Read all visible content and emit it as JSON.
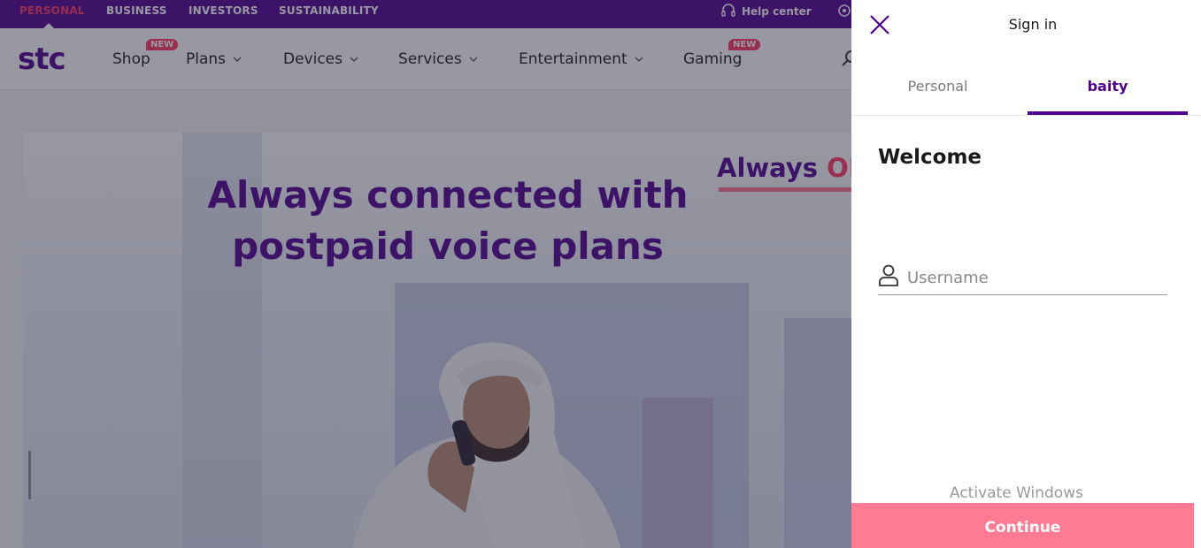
{
  "topbar": {
    "links": [
      {
        "label": "PERSONAL",
        "active": true
      },
      {
        "label": "BUSINESS",
        "active": false
      },
      {
        "label": "INVESTORS",
        "active": false
      },
      {
        "label": "SUSTAINABILITY",
        "active": false
      }
    ],
    "help_label": "Help center"
  },
  "nav": {
    "logo": "stc",
    "items": [
      {
        "label": "Shop",
        "badge": "NEW",
        "dropdown": false
      },
      {
        "label": "Plans",
        "dropdown": true
      },
      {
        "label": "Devices",
        "dropdown": true
      },
      {
        "label": "Services",
        "dropdown": true
      },
      {
        "label": "Entertainment",
        "dropdown": true
      },
      {
        "label": "Gaming",
        "badge": "NEW",
        "dropdown": false
      }
    ]
  },
  "hero": {
    "headline_line1": "Always connected with",
    "headline_line2": "postpaid voice plans",
    "badge_text": "Always ",
    "badge_on": "ON"
  },
  "signin": {
    "title": "Sign in",
    "tabs": [
      {
        "label": "Personal",
        "active": false
      },
      {
        "label": "baity",
        "active": true
      }
    ],
    "welcome": "Welcome",
    "username_placeholder": "Username",
    "continue_label": "Continue"
  },
  "watermark": "Activate Windows",
  "colors": {
    "brand_purple": "#4f008c",
    "accent_coral": "#ff375e",
    "continue_pink": "#ff7a93"
  }
}
